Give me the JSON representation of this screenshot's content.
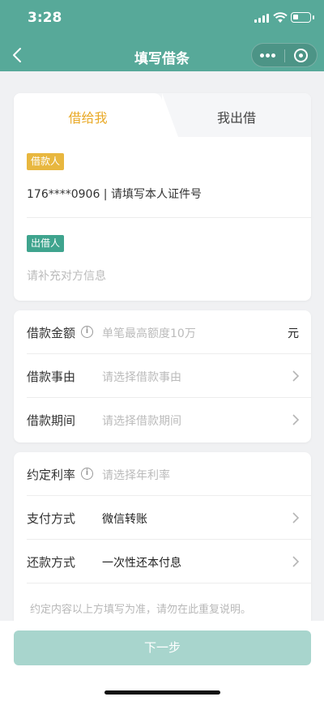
{
  "status": {
    "time": "3:28"
  },
  "nav": {
    "title": "填写借条"
  },
  "tabs": [
    {
      "label": "借给我"
    },
    {
      "label": "我出借"
    }
  ],
  "borrower": {
    "tag": "借款人",
    "text": "176****0906 | 请填写本人证件号"
  },
  "lender": {
    "tag": "出借人",
    "placeholder": "请补充对方信息"
  },
  "loan": {
    "amount": {
      "label": "借款金额",
      "placeholder": "单笔最高额度10万",
      "unit": "元"
    },
    "reason": {
      "label": "借款事由",
      "placeholder": "请选择借款事由"
    },
    "period": {
      "label": "借款期间",
      "placeholder": "请选择借款期间"
    }
  },
  "terms": {
    "rate": {
      "label": "约定利率",
      "placeholder": "请选择年利率"
    },
    "payment": {
      "label": "支付方式",
      "value": "微信转账"
    },
    "repayment": {
      "label": "还款方式",
      "value": "一次性还本付息"
    },
    "note": "约定内容以上方填写为准，请勿在此重复说明。"
  },
  "footer": {
    "next_label": "下一步"
  },
  "colors": {
    "primary": "#57a999",
    "accent": "#e9a926",
    "tag_borrower": "#e8b73f",
    "tag_lender": "#3fa48e",
    "button_disabled": "#a8d5cd"
  }
}
